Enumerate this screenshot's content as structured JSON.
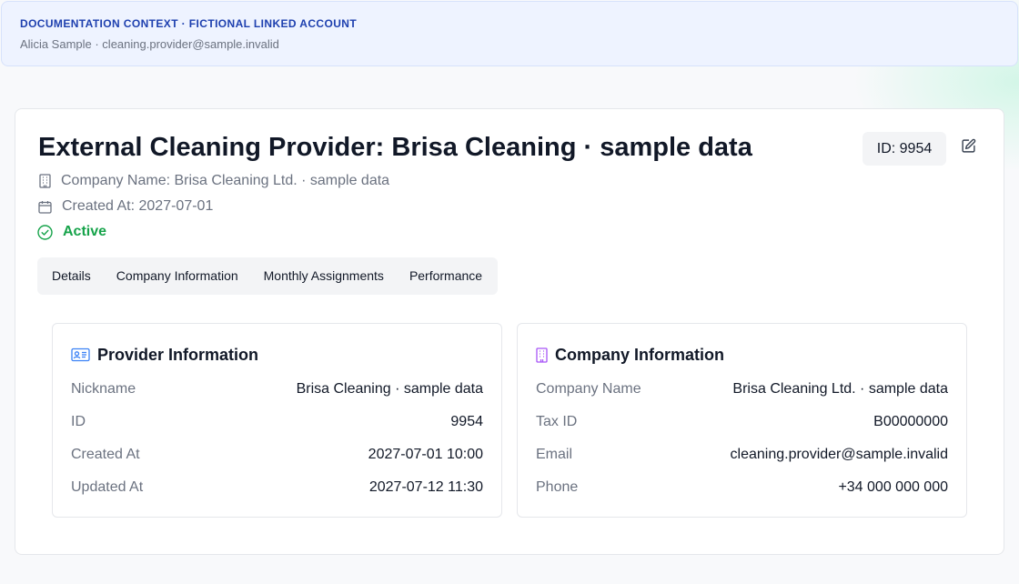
{
  "banner": {
    "title": "DOCUMENTATION CONTEXT · FICTIONAL LINKED ACCOUNT",
    "subtitle": "Alicia Sample · cleaning.provider@sample.invalid"
  },
  "header": {
    "title": "External Cleaning Provider: Brisa Cleaning · sample data",
    "id_badge": "ID: 9954",
    "company_line": "Company Name: Brisa Cleaning Ltd. · sample data",
    "created_line": "Created At: 2027-07-01",
    "status": "Active"
  },
  "tabs": [
    {
      "label": "Details"
    },
    {
      "label": "Company Information"
    },
    {
      "label": "Monthly Assignments"
    },
    {
      "label": "Performance"
    }
  ],
  "provider_info": {
    "title": "Provider Information",
    "rows": [
      {
        "label": "Nickname",
        "value": "Brisa Cleaning · sample data"
      },
      {
        "label": "ID",
        "value": "9954"
      },
      {
        "label": "Created At",
        "value": "2027-07-01 10:00"
      },
      {
        "label": "Updated At",
        "value": "2027-07-12 11:30"
      }
    ]
  },
  "company_info": {
    "title": "Company Information",
    "rows": [
      {
        "label": "Company Name",
        "value": "Brisa Cleaning Ltd. · sample data"
      },
      {
        "label": "Tax ID",
        "value": "B00000000"
      },
      {
        "label": "Email",
        "value": "cleaning.provider@sample.invalid"
      },
      {
        "label": "Phone",
        "value": "+34 000 000 000"
      }
    ]
  },
  "colors": {
    "banner_title": "#1e40af",
    "status_active": "#16a34a",
    "provider_icon": "#3b82f6",
    "company_icon": "#a855f7"
  },
  "icons": {
    "company": "building-icon",
    "created": "calendar-icon",
    "status": "check-circle-icon",
    "edit": "edit-icon",
    "provider_panel": "id-card-icon",
    "company_panel": "building-icon"
  }
}
